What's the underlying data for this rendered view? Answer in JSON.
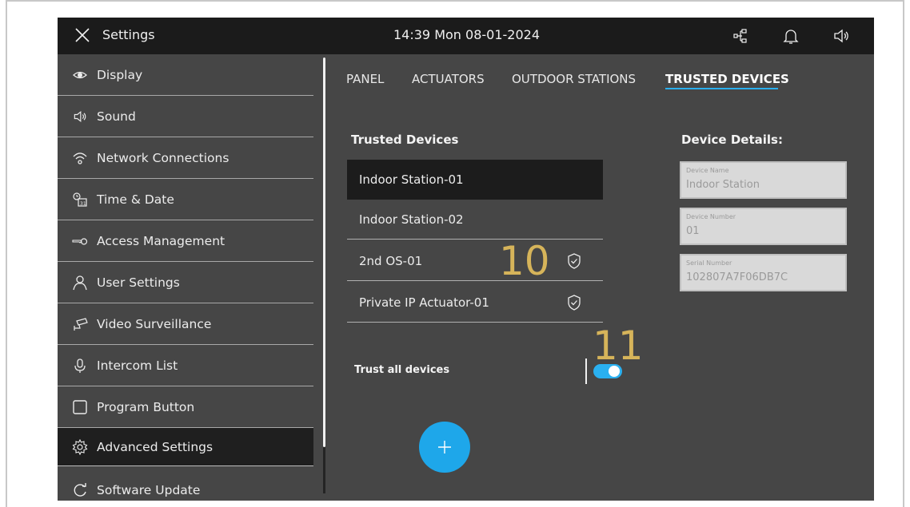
{
  "header": {
    "title": "Settings",
    "clock": "14:39  Mon 08-01-2024",
    "icons": [
      "close-icon",
      "network-icon",
      "bell-icon",
      "speaker-icon"
    ]
  },
  "sidebar": {
    "items": [
      {
        "label": "Display",
        "icon": "eye-icon"
      },
      {
        "label": "Sound",
        "icon": "speaker-icon"
      },
      {
        "label": "Network Connections",
        "icon": "wifi-icon"
      },
      {
        "label": "Time & Date",
        "icon": "clock-calendar-icon"
      },
      {
        "label": "Access Management",
        "icon": "key-icon"
      },
      {
        "label": "User Settings",
        "icon": "user-icon"
      },
      {
        "label": "Video Surveillance",
        "icon": "camera-icon"
      },
      {
        "label": "Intercom List",
        "icon": "microphone-icon"
      },
      {
        "label": "Program Button",
        "icon": "square-icon"
      },
      {
        "label": "Advanced Settings",
        "icon": "gear-icon",
        "active": true
      },
      {
        "label": "Software Update",
        "icon": "refresh-icon"
      }
    ]
  },
  "tabs": [
    {
      "label": "PANEL"
    },
    {
      "label": "ACTUATORS"
    },
    {
      "label": "OUTDOOR STATIONS"
    },
    {
      "label": "TRUSTED DEVICES",
      "active": true
    }
  ],
  "trusted": {
    "title": "Trusted Devices",
    "devices": [
      {
        "name": "Indoor Station-01",
        "selected": true,
        "shield": false
      },
      {
        "name": "Indoor Station-02",
        "selected": false,
        "shield": false
      },
      {
        "name": "2nd OS-01",
        "selected": false,
        "shield": true
      },
      {
        "name": "Private IP Actuator-01",
        "selected": false,
        "shield": true
      }
    ],
    "trust_all_label": "Trust all devices",
    "trust_all_on": true
  },
  "details": {
    "title": "Device Details:",
    "fields": [
      {
        "label": "Device Name",
        "value": "Indoor Station"
      },
      {
        "label": "Device Number",
        "value": "01"
      },
      {
        "label": "Serial Number",
        "value": "102807A7F06DB7C"
      }
    ]
  },
  "callouts": [
    "10",
    "11"
  ],
  "colors": {
    "accent": "#2ab0f0",
    "fab": "#1ea7ea",
    "callout": "#d6b45a",
    "panel": "#464646",
    "topbar": "#1b1b1b"
  },
  "fab": {
    "label": "+"
  }
}
